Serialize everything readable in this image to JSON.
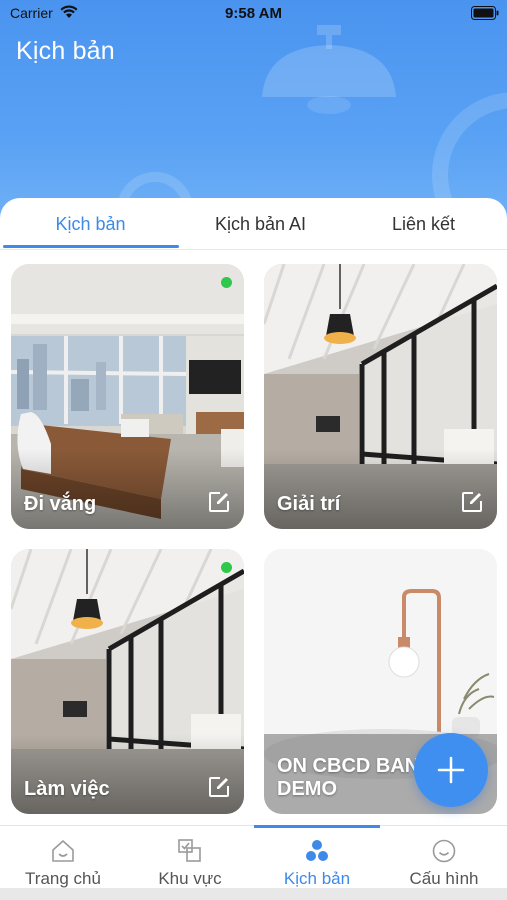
{
  "status_bar": {
    "carrier": "Carrier",
    "time": "9:58 AM"
  },
  "header": {
    "title": "Kịch bản"
  },
  "tabs": [
    {
      "label": "Kịch bản",
      "active": true
    },
    {
      "label": "Kịch bản AI",
      "active": false
    },
    {
      "label": "Liên kết",
      "active": false
    }
  ],
  "scenes": [
    {
      "label": "Đi vắng",
      "active_indicator": true,
      "image": "office-room"
    },
    {
      "label": "Giải trí",
      "active_indicator": false,
      "image": "glass-partition-office"
    },
    {
      "label": "Làm việc",
      "active_indicator": true,
      "image": "glass-partition-office"
    },
    {
      "label": "ON CBCD BAN DEMO",
      "active_indicator": false,
      "image": "pendant-lamp"
    }
  ],
  "fab": {
    "icon": "plus-icon"
  },
  "bottom_nav": [
    {
      "label": "Trang chủ",
      "icon": "home-icon",
      "active": false
    },
    {
      "label": "Khu vực",
      "icon": "area-icon",
      "active": false
    },
    {
      "label": "Kịch bản",
      "icon": "scene-icon",
      "active": true
    },
    {
      "label": "Cấu hình",
      "icon": "smile-icon",
      "active": false
    }
  ],
  "colors": {
    "accent": "#3d8ae8",
    "header": "#4a94f0",
    "online": "#2ec84a"
  }
}
